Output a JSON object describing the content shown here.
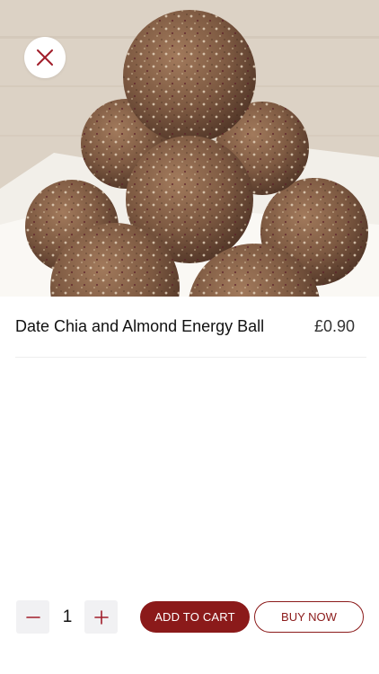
{
  "product": {
    "name": "Date Chia and Almond Energy Ball",
    "price": "£0.90",
    "image_icon": "energy-balls-photo"
  },
  "actions": {
    "close_icon": "close-icon",
    "quantity": "1",
    "minus_icon": "minus-icon",
    "plus_icon": "plus-icon",
    "add_to_cart_label": "ADD TO CART",
    "buy_now_label": "BUY NOW"
  },
  "colors": {
    "accent": "#8b1a1a",
    "stepper_bg": "#f1f1f3",
    "text": "#111111"
  }
}
